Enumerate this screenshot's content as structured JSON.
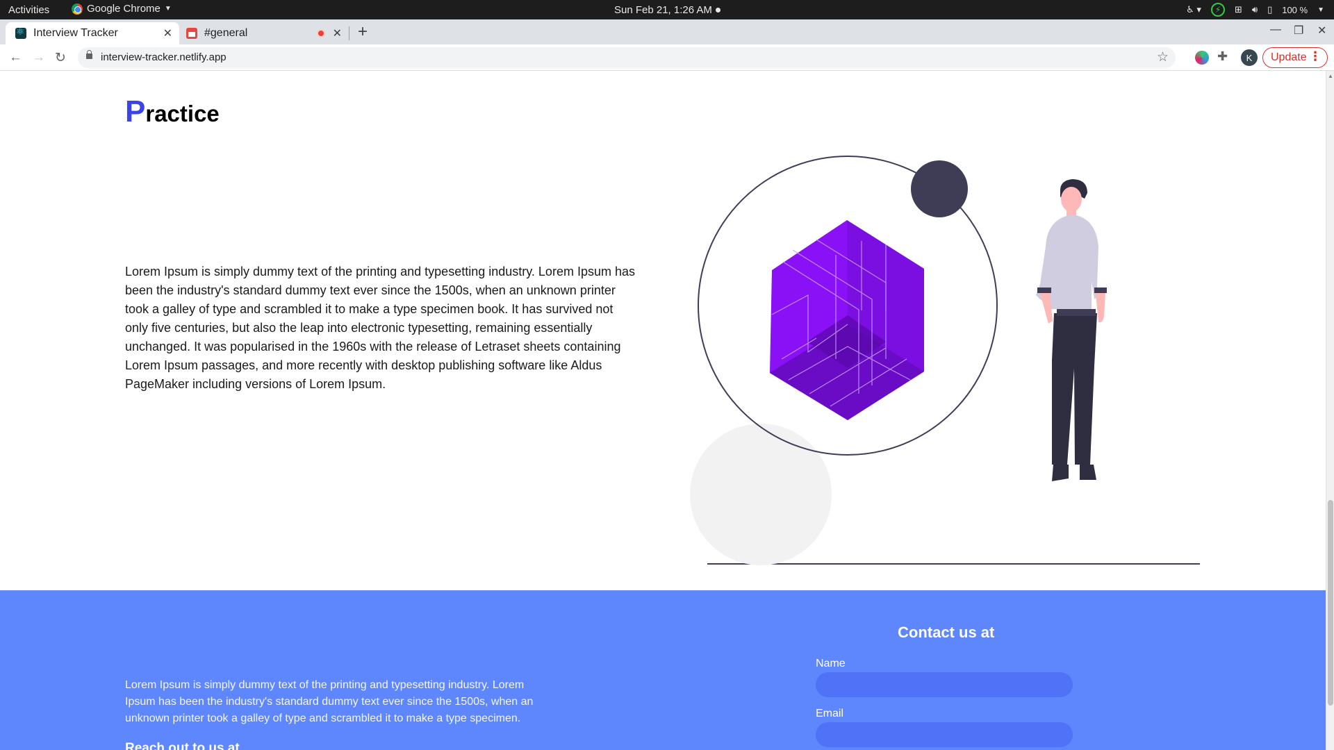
{
  "system_bar": {
    "activities": "Activities",
    "app_name": "Google Chrome",
    "clock": "Sun Feb 21,  1:26 AM",
    "battery": "100 %"
  },
  "browser": {
    "tabs": [
      {
        "label": "Interview Tracker",
        "active": true,
        "icon": "react-icon"
      },
      {
        "label": "#general",
        "active": false,
        "icon": "calendar-icon"
      }
    ],
    "url": "interview-tracker.netlify.app",
    "profile_initial": "K",
    "update_label": "Update"
  },
  "practice": {
    "heading_first_letter": "P",
    "heading_rest": "ractice",
    "paragraph": "Lorem Ipsum is simply dummy text of the printing and typesetting industry. Lorem Ipsum has been the industry's standard dummy text ever since the 1500s, when an unknown printer took a galley of type and scrambled it to make a type specimen book. It has survived not only five centuries, but also the leap into electronic typesetting, remaining essentially unchanged. It was popularised in the 1960s with the release of Letraset sheets containing Lorem Ipsum passages, and more recently with desktop publishing software like Aldus PageMaker including versions of Lorem Ipsum."
  },
  "footer": {
    "paragraph": "Lorem Ipsum is simply dummy text of the printing and typesetting industry. Lorem Ipsum has been the industry's standard dummy text ever since the 1500s, when an unknown printer took a galley of type and scrambled it to make a type specimen.",
    "reach_out": "Reach out to us at",
    "contact_title": "Contact us at",
    "name_label": "Name",
    "email_label": "Email"
  },
  "colors": {
    "accent": "#3a44e8",
    "footer_bg": "#5f87fd",
    "cube": "#8a10f5",
    "update_red": "#d93025"
  }
}
